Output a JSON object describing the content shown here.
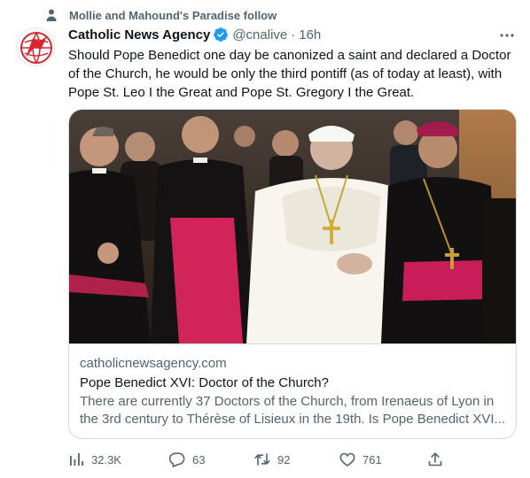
{
  "social_context": {
    "text": "Mollie and Mahound's Paradise follow"
  },
  "author": {
    "name": "Catholic News Agency",
    "handle": "@cnalive",
    "time": "16h",
    "verified": true
  },
  "tweet": {
    "text": "Should Pope Benedict one day be canonized a saint and declared a Doctor of the Church, he would be only the third pontiff (as of today at least), with Pope St. Leo I the Great and Pope St. Gregory I the Great."
  },
  "card": {
    "domain": "catholicnewsagency.com",
    "title": "Pope Benedict XVI: Doctor of the Church?",
    "description": "There are currently 37 Doctors of the Church, from Irenaeus of Lyon in the 3rd century to Thérèse of Lisieux in the 19th. Is Pope Benedict XVI..."
  },
  "actions": {
    "views": "32.3K",
    "replies": "63",
    "retweets": "92",
    "likes": "761"
  },
  "icons": [
    "person-icon",
    "cna-logo-icon",
    "verified-badge-icon",
    "more-icon",
    "views-icon",
    "reply-icon",
    "retweet-icon",
    "like-icon",
    "share-icon"
  ],
  "colors": {
    "text": "#0f1419",
    "secondary": "#536471",
    "verified": "#1d9bf0",
    "border": "#cfd9de",
    "logo_red": "#d6262e"
  }
}
